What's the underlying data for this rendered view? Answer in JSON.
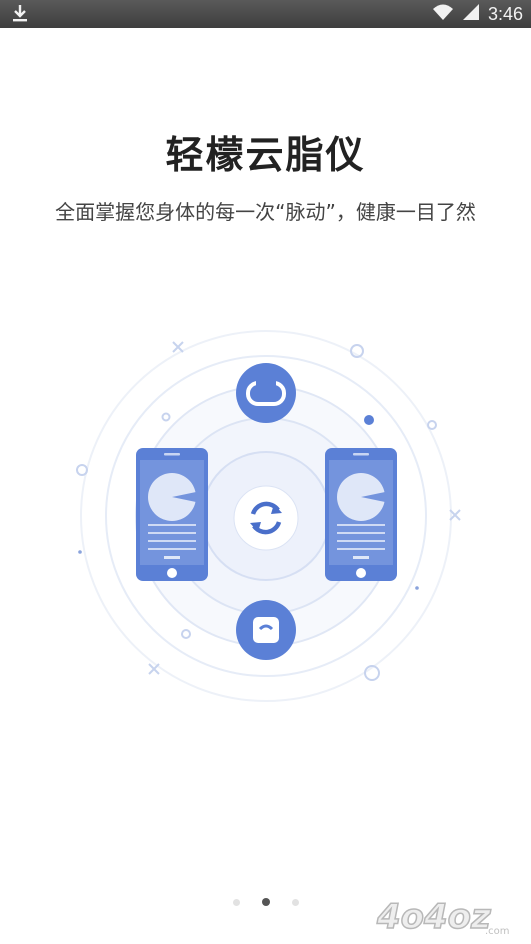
{
  "status_bar": {
    "time": "3:46",
    "icons": [
      "download-icon",
      "wifi-icon",
      "signal-icon"
    ]
  },
  "onboarding": {
    "title": "轻檬云脂仪",
    "subtitle": "全面掌握您身体的每一次“脉动”，健康一目了然",
    "page_indicator": {
      "total": 3,
      "current": 2
    }
  },
  "illustration": {
    "icons": [
      "sync-icon",
      "band-icon",
      "scale-icon",
      "phone-icon"
    ],
    "accent_color": "#5b80d6"
  },
  "watermark": {
    "text": "4o4oz",
    "suffix": ".com"
  }
}
